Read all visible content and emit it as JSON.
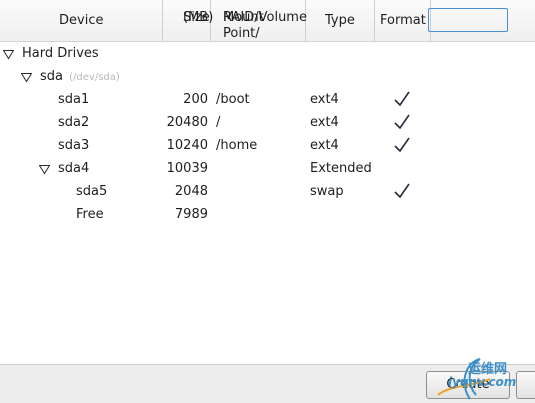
{
  "columns": {
    "device": "Device",
    "size_line1": "Size",
    "size_line2": "(MB)",
    "mount_line1": "Mount Point/",
    "mount_line2": "RAID/Volume",
    "type": "Type",
    "format": "Format"
  },
  "tree": {
    "group": "Hard Drives",
    "disk": "sda",
    "disk_path": "(/dev/sda)"
  },
  "rows": [
    {
      "device": "sda1",
      "size": "200",
      "mount": "/boot",
      "type": "ext4",
      "format": true
    },
    {
      "device": "sda2",
      "size": "20480",
      "mount": "/",
      "type": "ext4",
      "format": true
    },
    {
      "device": "sda3",
      "size": "10240",
      "mount": "/home",
      "type": "ext4",
      "format": true
    },
    {
      "device": "sda4",
      "size": "10039",
      "mount": "",
      "type": "Extended",
      "format": false
    },
    {
      "device": "sda5",
      "size": "2048",
      "mount": "",
      "type": "swap",
      "format": true
    },
    {
      "device": "Free",
      "size": "7989",
      "mount": "",
      "type": "",
      "format": false
    }
  ],
  "check_glyph": "✓",
  "buttons": {
    "create": "Create"
  },
  "watermark": {
    "line1": "运维网",
    "line2": "iyunv.com"
  }
}
